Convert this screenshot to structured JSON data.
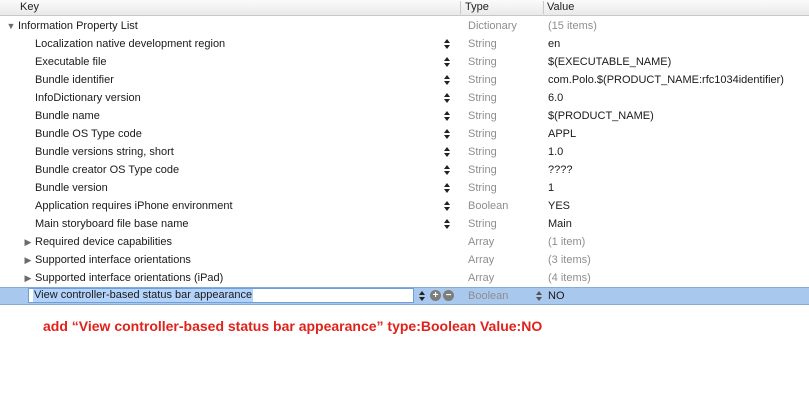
{
  "header": {
    "key": "Key",
    "type": "Type",
    "value": "Value"
  },
  "root": {
    "key": "Information Property List",
    "type": "Dictionary",
    "value": "(15 items)"
  },
  "rows": [
    {
      "key": "Localization native development region",
      "type": "String",
      "value": "en"
    },
    {
      "key": "Executable file",
      "type": "String",
      "value": "$(EXECUTABLE_NAME)"
    },
    {
      "key": "Bundle identifier",
      "type": "String",
      "value": "com.Polo.$(PRODUCT_NAME:rfc1034identifier)"
    },
    {
      "key": "InfoDictionary version",
      "type": "String",
      "value": "6.0"
    },
    {
      "key": "Bundle name",
      "type": "String",
      "value": "$(PRODUCT_NAME)"
    },
    {
      "key": "Bundle OS Type code",
      "type": "String",
      "value": "APPL"
    },
    {
      "key": "Bundle versions string, short",
      "type": "String",
      "value": "1.0"
    },
    {
      "key": "Bundle creator OS Type code",
      "type": "String",
      "value": "????"
    },
    {
      "key": "Bundle version",
      "type": "String",
      "value": "1"
    },
    {
      "key": "Application requires iPhone environment",
      "type": "Boolean",
      "value": "YES"
    },
    {
      "key": "Main storyboard file base name",
      "type": "String",
      "value": "Main"
    },
    {
      "key": "Required device capabilities",
      "type": "Array",
      "value": "(1 item)"
    },
    {
      "key": "Supported interface orientations",
      "type": "Array",
      "value": "(3 items)"
    },
    {
      "key": "Supported interface orientations (iPad)",
      "type": "Array",
      "value": "(4 items)"
    }
  ],
  "selected": {
    "key": "View controller-based status bar appearance",
    "type": "Boolean",
    "value": "NO",
    "add_glyph": "+",
    "remove_glyph": "−"
  },
  "note": "add  “View controller-based status bar appearance”  type:Boolean  Value:NO"
}
